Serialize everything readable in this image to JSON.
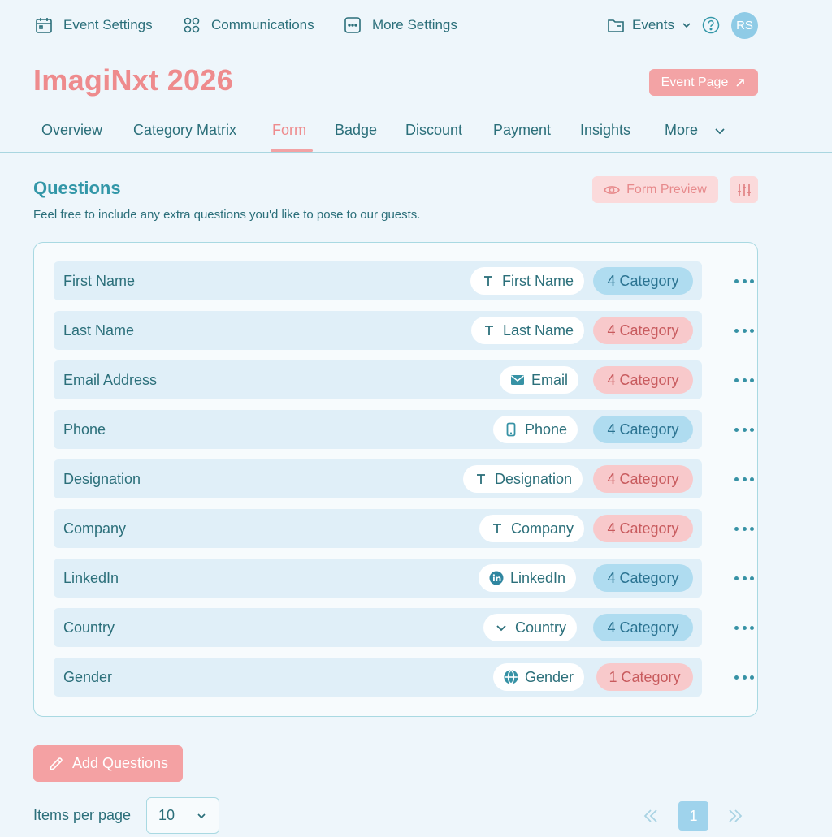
{
  "topnav": {
    "event_settings": "Event Settings",
    "communications": "Communications",
    "more_settings": "More Settings",
    "events": "Events",
    "avatar": "RS"
  },
  "header": {
    "title": "ImagiNxt 2026",
    "event_page_label": "Event Page"
  },
  "tabs": [
    "Overview",
    "Category Matrix",
    "Form",
    "Badge",
    "Discount",
    "Payment",
    "Insights",
    "More"
  ],
  "active_tab": "Form",
  "questions": {
    "title": "Questions",
    "subtitle": "Feel free to include any extra questions you'd like to pose to our guests.",
    "form_preview_label": "Form Preview",
    "rows": [
      {
        "label": "First Name",
        "type": "First Name",
        "type_icon": "text-icon",
        "category": "4 Category",
        "category_color": "blue"
      },
      {
        "label": "Last Name",
        "type": "Last Name",
        "type_icon": "text-icon",
        "category": "4 Category",
        "category_color": "pink"
      },
      {
        "label": "Email Address",
        "type": "Email",
        "type_icon": "email-icon",
        "category": "4 Category",
        "category_color": "pink"
      },
      {
        "label": "Phone",
        "type": "Phone",
        "type_icon": "phone-icon",
        "category": "4 Category",
        "category_color": "blue"
      },
      {
        "label": "Designation",
        "type": "Designation",
        "type_icon": "text-icon",
        "category": "4 Category",
        "category_color": "pink"
      },
      {
        "label": "Company",
        "type": "Company",
        "type_icon": "text-icon",
        "category": "4 Category",
        "category_color": "pink"
      },
      {
        "label": "LinkedIn",
        "type": "LinkedIn",
        "type_icon": "linkedin-icon",
        "category": "4 Category",
        "category_color": "blue"
      },
      {
        "label": "Country",
        "type": "Country",
        "type_icon": "chevron-down-icon",
        "category": "4 Category",
        "category_color": "blue"
      },
      {
        "label": "Gender",
        "type": "Gender",
        "type_icon": "globe-icon",
        "category": "1 Category",
        "category_color": "pink"
      }
    ]
  },
  "footer": {
    "add_questions_label": "Add Questions",
    "items_per_page_label": "Items per page",
    "items_per_page_value": "10",
    "current_page": "1"
  },
  "colors": {
    "accent_pink": "#ee8b8d",
    "accent_teal": "#3397a8",
    "background": "#eef6fb"
  }
}
